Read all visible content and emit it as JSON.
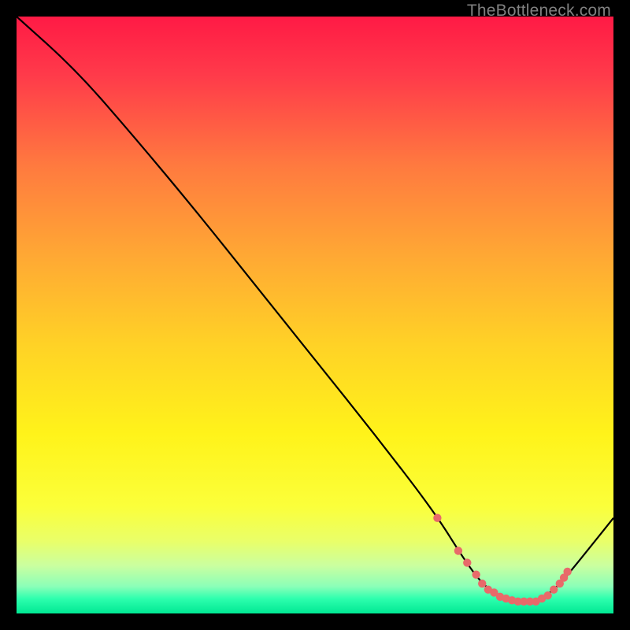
{
  "watermark": {
    "text": "TheBottleneck.com"
  },
  "chart_data": {
    "type": "line",
    "title": "",
    "xlabel": "",
    "ylabel": "",
    "xlim": [
      0,
      100
    ],
    "ylim": [
      0,
      100
    ],
    "series": [
      {
        "name": "curve",
        "x": [
          0,
          10,
          20,
          30,
          40,
          50,
          60,
          70,
          75,
          78,
          80,
          82,
          84,
          86,
          88,
          90,
          92,
          100
        ],
        "y": [
          100,
          91,
          79.5,
          67.5,
          55,
          42.5,
          30,
          17,
          9,
          5,
          3.5,
          2.5,
          2,
          2,
          2.5,
          4,
          6,
          16
        ]
      }
    ],
    "markers": {
      "name": "highlight-dots",
      "color": "#e86a6a",
      "x": [
        70.5,
        74,
        75.5,
        77,
        78,
        79,
        80,
        81,
        82,
        83,
        84,
        85,
        86,
        87,
        88,
        89,
        90,
        91,
        91.7,
        92.3
      ],
      "y": [
        16,
        10.5,
        8.5,
        6.5,
        5,
        4,
        3.5,
        2.8,
        2.5,
        2.2,
        2,
        2,
        2,
        2,
        2.5,
        3,
        4,
        5,
        6,
        7
      ]
    },
    "gradient_stops": [
      {
        "offset": 0.0,
        "color": "#ff1a45"
      },
      {
        "offset": 0.1,
        "color": "#ff3b4a"
      },
      {
        "offset": 0.25,
        "color": "#ff7a3f"
      },
      {
        "offset": 0.4,
        "color": "#ffa834"
      },
      {
        "offset": 0.55,
        "color": "#ffd226"
      },
      {
        "offset": 0.7,
        "color": "#fff31a"
      },
      {
        "offset": 0.82,
        "color": "#fbff3a"
      },
      {
        "offset": 0.88,
        "color": "#e9ff6a"
      },
      {
        "offset": 0.92,
        "color": "#caffa0"
      },
      {
        "offset": 0.955,
        "color": "#8affb8"
      },
      {
        "offset": 0.975,
        "color": "#2effae"
      },
      {
        "offset": 1.0,
        "color": "#00e893"
      }
    ]
  }
}
